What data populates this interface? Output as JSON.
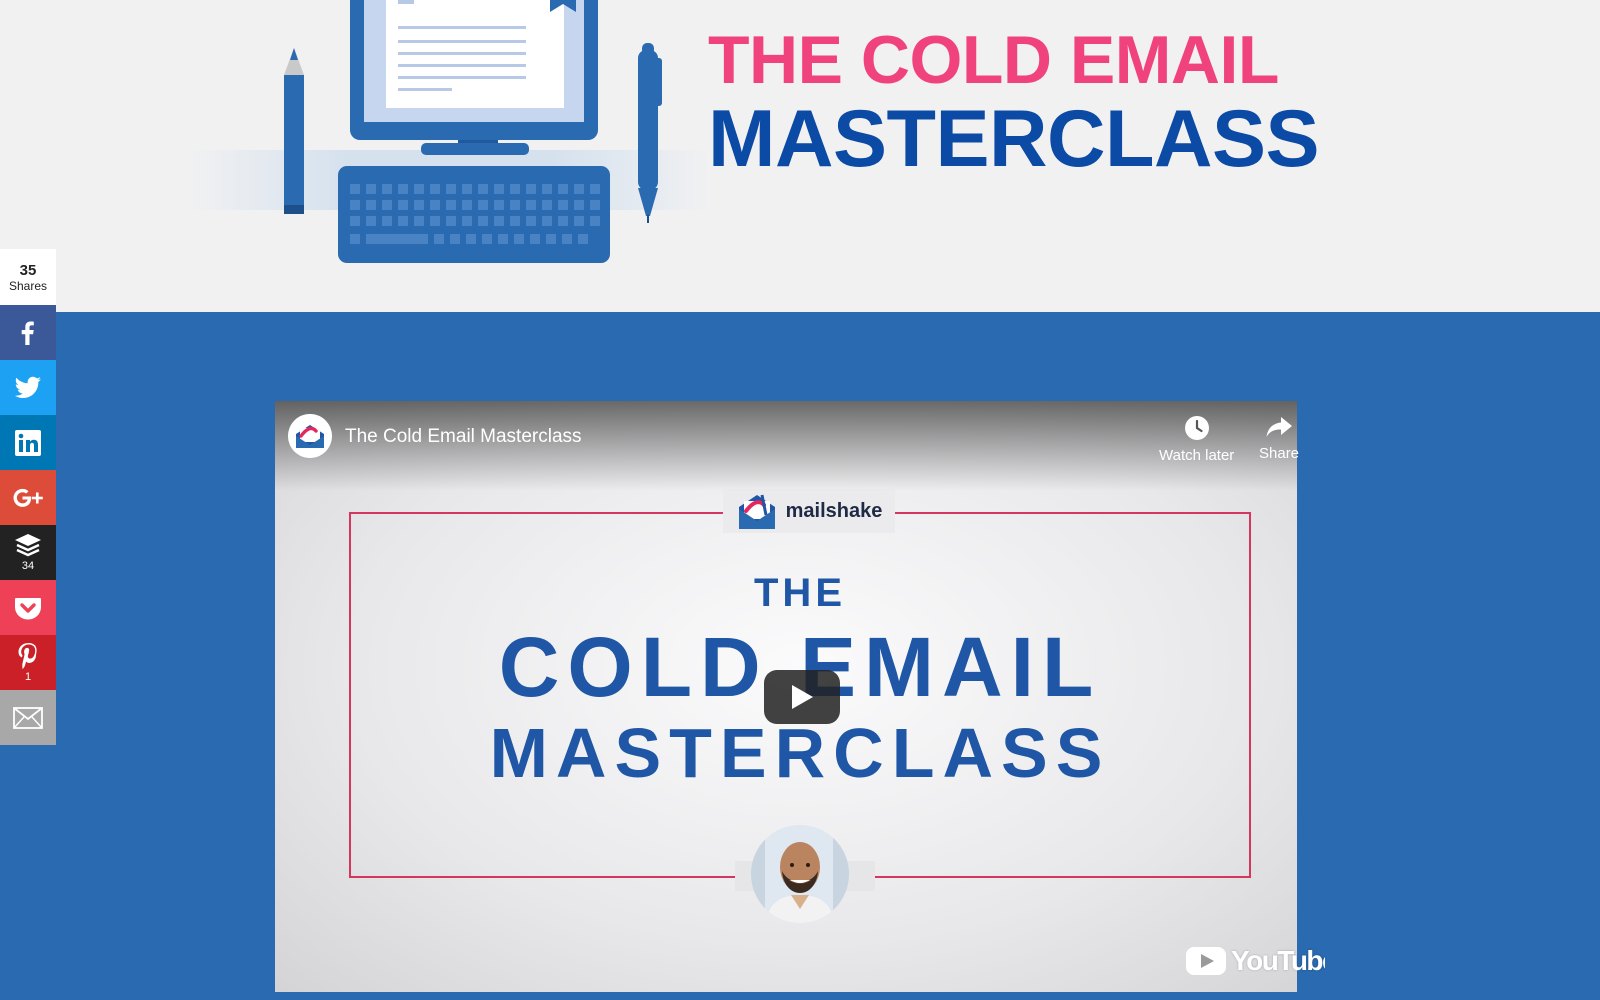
{
  "hero": {
    "title_line1": "THE COLD EMAIL",
    "title_line2": "MASTERCLASS",
    "title_line1_color": "#f0437e",
    "title_line2_color": "#0b4aa5",
    "illustration_icon": "computer-desk-icon"
  },
  "colors": {
    "section_background": "#2a6ab0",
    "hero_background": "#f1f1f2",
    "illustration_blue": "#2a6ab0"
  },
  "share_bar": {
    "total_count": "35",
    "total_label": "Shares",
    "buttons": [
      {
        "network": "Facebook",
        "icon": "facebook-icon",
        "color": "#3b5998",
        "count": ""
      },
      {
        "network": "Twitter",
        "icon": "twitter-icon",
        "color": "#1da1f2",
        "count": ""
      },
      {
        "network": "LinkedIn",
        "icon": "linkedin-icon",
        "color": "#0077b5",
        "count": ""
      },
      {
        "network": "Google+",
        "icon": "google-plus-icon",
        "color": "#dd4b39",
        "count": ""
      },
      {
        "network": "Buffer",
        "icon": "buffer-icon",
        "color": "#222222",
        "count": "34"
      },
      {
        "network": "Pocket",
        "icon": "pocket-icon",
        "color": "#ee4056",
        "count": ""
      },
      {
        "network": "Pinterest",
        "icon": "pinterest-icon",
        "color": "#cb2027",
        "count": "1"
      },
      {
        "network": "Email",
        "icon": "email-icon",
        "color": "#a8a8a8",
        "count": ""
      }
    ]
  },
  "video": {
    "title": "The Cold Email Masterclass",
    "watch_later_label": "Watch later",
    "share_label": "Share",
    "platform_label": "YouTube",
    "thumbnail": {
      "brand": "mailshake",
      "line1": "THE",
      "line2": "COLD EMAIL",
      "line3": "MASTERCLASS",
      "frame_color": "#d3365f",
      "text_color": "#1f56a5"
    }
  }
}
